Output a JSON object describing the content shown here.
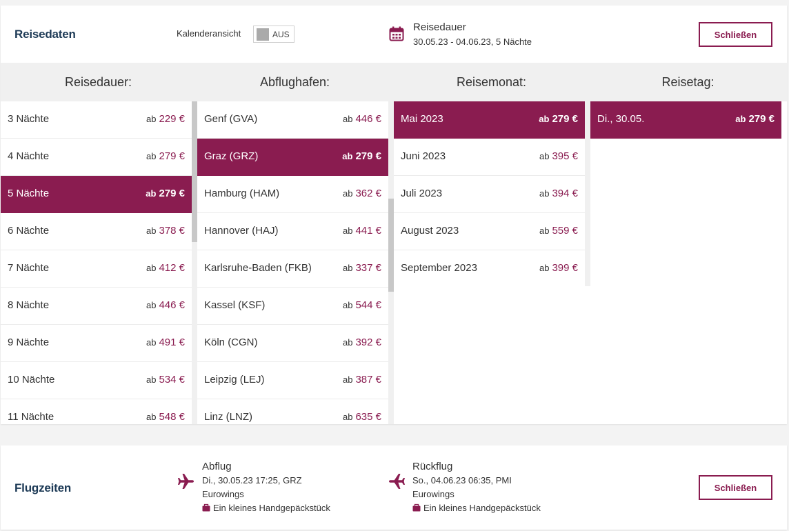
{
  "colors": {
    "accent": "#8a1c50",
    "title": "#1d3a56",
    "header_bg": "#f0f0f0"
  },
  "reisedaten": {
    "title": "Reisedaten",
    "calendar_toggle": {
      "label": "Kalenderansicht",
      "state": "AUS"
    },
    "summary": {
      "icon": "calendar-icon",
      "title": "Reisedauer",
      "value": "30.05.23 - 04.06.23,  5 Nächte"
    },
    "close_label": "Schließen",
    "columns": {
      "dauer": {
        "header": "Reisedauer:",
        "rows": [
          {
            "label": "3 Nächte",
            "ab": "ab",
            "price": "229 €"
          },
          {
            "label": "4 Nächte",
            "ab": "ab",
            "price": "279 €"
          },
          {
            "label": "5 Nächte",
            "ab": "ab",
            "price": "279 €",
            "selected": true
          },
          {
            "label": "6 Nächte",
            "ab": "ab",
            "price": "378 €"
          },
          {
            "label": "7 Nächte",
            "ab": "ab",
            "price": "412 €"
          },
          {
            "label": "8 Nächte",
            "ab": "ab",
            "price": "446 €"
          },
          {
            "label": "9 Nächte",
            "ab": "ab",
            "price": "491 €"
          },
          {
            "label": "10 Nächte",
            "ab": "ab",
            "price": "534 €"
          },
          {
            "label": "11 Nächte",
            "ab": "ab",
            "price": "548 €"
          }
        ]
      },
      "flughafen": {
        "header": "Abflughafen:",
        "rows": [
          {
            "label": "Genf (GVA)",
            "ab": "ab",
            "price": "446 €"
          },
          {
            "label": "Graz (GRZ)",
            "ab": "ab",
            "price": "279 €",
            "selected": true
          },
          {
            "label": "Hamburg (HAM)",
            "ab": "ab",
            "price": "362 €"
          },
          {
            "label": "Hannover (HAJ)",
            "ab": "ab",
            "price": "441 €"
          },
          {
            "label": "Karlsruhe-Baden (FKB)",
            "ab": "ab",
            "price": "337 €"
          },
          {
            "label": "Kassel (KSF)",
            "ab": "ab",
            "price": "544 €"
          },
          {
            "label": "Köln (CGN)",
            "ab": "ab",
            "price": "392 €"
          },
          {
            "label": "Leipzig (LEJ)",
            "ab": "ab",
            "price": "387 €"
          },
          {
            "label": "Linz (LNZ)",
            "ab": "ab",
            "price": "635 €"
          }
        ]
      },
      "monat": {
        "header": "Reisemonat:",
        "rows": [
          {
            "label": "Mai 2023",
            "ab": "ab",
            "price": "279 €",
            "selected": true
          },
          {
            "label": "Juni 2023",
            "ab": "ab",
            "price": "395 €"
          },
          {
            "label": "Juli 2023",
            "ab": "ab",
            "price": "394 €"
          },
          {
            "label": "August 2023",
            "ab": "ab",
            "price": "559 €"
          },
          {
            "label": "September 2023",
            "ab": "ab",
            "price": "399 €"
          }
        ]
      },
      "tag": {
        "header": "Reisetag:",
        "rows": [
          {
            "label": "Di., 30.05.",
            "ab": "ab",
            "price": "279 €",
            "selected": true
          }
        ]
      }
    }
  },
  "flugzeiten": {
    "title": "Flugzeiten",
    "close_label": "Schließen",
    "abflug": {
      "icon": "plane-departure-icon",
      "title": "Abflug",
      "datetime": "Di., 30.05.23 17:25, GRZ",
      "airline": "Eurowings",
      "baggage_icon": "bag-icon",
      "baggage": "Ein kleines Handgepäckstück"
    },
    "rueckflug": {
      "icon": "plane-return-icon",
      "title": "Rückflug",
      "datetime": "So., 04.06.23 06:35, PMI",
      "airline": "Eurowings",
      "baggage_icon": "bag-icon",
      "baggage": "Ein kleines Handgepäckstück"
    }
  }
}
